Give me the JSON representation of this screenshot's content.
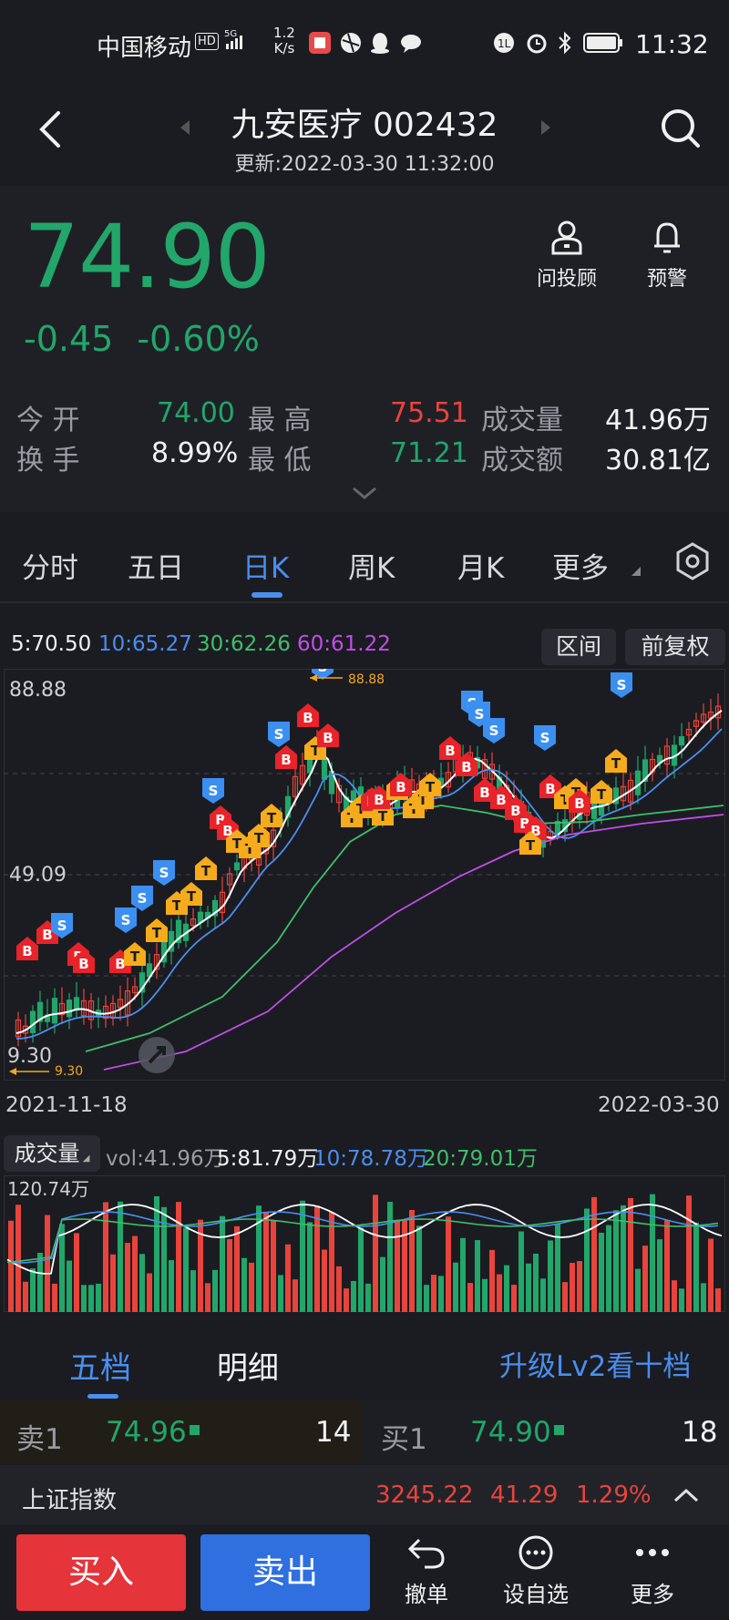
{
  "status_bar": {
    "carrier": "中国移动",
    "network_speed_line1": "1.2",
    "network_speed_line2": "K/s",
    "time": "11:32"
  },
  "header": {
    "title": "九安医疗 002432",
    "updated": "更新:2022-03-30 11:32:00"
  },
  "quote": {
    "price": "74.90",
    "change": "-0.45",
    "change_pct": "-0.60%",
    "advisor_label": "问投顾",
    "alert_label": "预警",
    "open_label": "今  开",
    "open": "74.00",
    "high_label": "最  高",
    "high": "75.51",
    "volume_label": "成交量",
    "volume": "41.96万",
    "turnover_label": "换  手",
    "turnover": "8.99%",
    "low_label": "最  低",
    "low": "71.21",
    "amount_label": "成交额",
    "amount": "30.81亿"
  },
  "chart_tabs": [
    "分时",
    "五日",
    "日K",
    "周K",
    "月K",
    "更多"
  ],
  "active_tab": "日K",
  "ma": {
    "ma5": "5:70.50",
    "ma10": "10:65.27",
    "ma30": "30:62.26",
    "ma60": "60:61.22",
    "range_btn": "区间",
    "adjust_btn": "前复权"
  },
  "kchart": {
    "max_label": "88.88",
    "mid_label": "49.09",
    "min_label": "9.30",
    "max_marker": "88.88",
    "min_marker": "9.30",
    "start_date": "2021-11-18",
    "end_date": "2022-03-30"
  },
  "volume": {
    "selector": "成交量",
    "vol": "vol:41.96万",
    "ma5": "5:81.79万",
    "ma10": "10:78.78万",
    "ma20": "20:79.01万",
    "max_label": "120.74万"
  },
  "depth": {
    "tab_five": "五档",
    "tab_detail": "明细",
    "upgrade": "升级Lv2看十档",
    "sell_label": "卖1",
    "sell_price": "74.96",
    "sell_qty": "14",
    "buy_label": "买1",
    "buy_price": "74.90",
    "buy_qty": "18"
  },
  "index": {
    "name": "上证指数",
    "value": "3245.22",
    "change": "41.29",
    "pct": "1.29%"
  },
  "bottom_bar": {
    "buy": "买入",
    "sell": "卖出",
    "cancel": "撤单",
    "watchlist": "设自选",
    "more": "更多"
  },
  "colors": {
    "up": "#e8443c",
    "down": "#22a66a",
    "accent": "#4a8ef0",
    "buy_btn": "#e5343a",
    "sell_btn": "#2f6fe0"
  }
}
